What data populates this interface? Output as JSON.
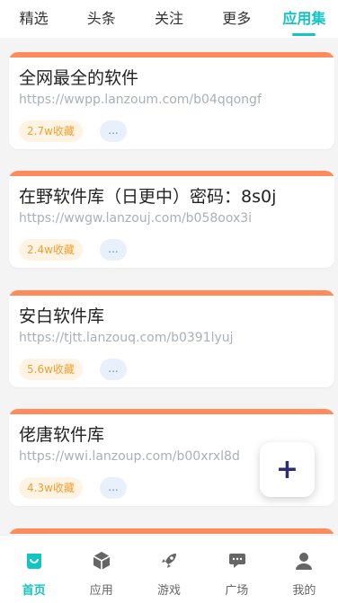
{
  "top_tabs": [
    {
      "label": "精选"
    },
    {
      "label": "头条"
    },
    {
      "label": "关注"
    },
    {
      "label": "更多"
    },
    {
      "label": "应用集"
    }
  ],
  "cards": [
    {
      "title": "全网最全的软件",
      "url": "https://wwpp.lanzoum.com/b04qqongf",
      "favorites": "2.7w收藏",
      "more": "..."
    },
    {
      "title": "在野软件库（日更中）密码：8s0j",
      "url": "https://wwgw.lanzouj.com/b058oox3i",
      "favorites": "2.4w收藏",
      "more": "..."
    },
    {
      "title": "安白软件库",
      "url": "https://tjtt.lanzouq.com/b0391lyuj",
      "favorites": "5.6w收藏",
      "more": "..."
    },
    {
      "title": "佬唐软件库",
      "url": "https://wwi.lanzoup.com/b00xrxl8d",
      "favorites": "4.3w收藏",
      "more": "..."
    }
  ],
  "fab": {
    "symbol": "+"
  },
  "bottom_nav": [
    {
      "label": "首页",
      "icon": "home-bag-icon"
    },
    {
      "label": "应用",
      "icon": "cube-icon"
    },
    {
      "label": "游戏",
      "icon": "rocket-icon"
    },
    {
      "label": "广场",
      "icon": "chat-icon"
    },
    {
      "label": "我的",
      "icon": "user-icon"
    }
  ],
  "colors": {
    "accent": "#12c4c4",
    "card_top": "#ff8a5b",
    "badge_text": "#f0a030"
  }
}
